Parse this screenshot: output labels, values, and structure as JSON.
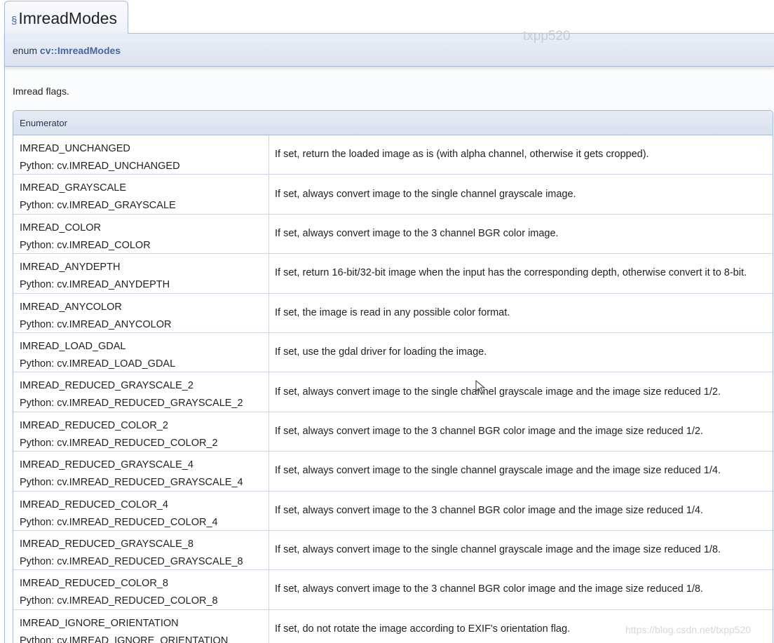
{
  "heading": {
    "anchor_symbol": "§",
    "title": "ImreadModes"
  },
  "declaration": {
    "keyword": "enum",
    "name": "cv::ImreadModes"
  },
  "description": "Imread flags.",
  "table": {
    "header": "Enumerator",
    "rows": [
      {
        "name": "IMREAD_UNCHANGED",
        "python": "Python: cv.IMREAD_UNCHANGED",
        "description": "If set, return the loaded image as is (with alpha channel, otherwise it gets cropped)."
      },
      {
        "name": "IMREAD_GRAYSCALE",
        "python": "Python: cv.IMREAD_GRAYSCALE",
        "description": "If set, always convert image to the single channel grayscale image."
      },
      {
        "name": "IMREAD_COLOR",
        "python": "Python: cv.IMREAD_COLOR",
        "description": "If set, always convert image to the 3 channel BGR color image."
      },
      {
        "name": "IMREAD_ANYDEPTH",
        "python": "Python: cv.IMREAD_ANYDEPTH",
        "description": "If set, return 16-bit/32-bit image when the input has the corresponding depth, otherwise convert it to 8-bit."
      },
      {
        "name": "IMREAD_ANYCOLOR",
        "python": "Python: cv.IMREAD_ANYCOLOR",
        "description": "If set, the image is read in any possible color format."
      },
      {
        "name": "IMREAD_LOAD_GDAL",
        "python": "Python: cv.IMREAD_LOAD_GDAL",
        "description": "If set, use the gdal driver for loading the image."
      },
      {
        "name": "IMREAD_REDUCED_GRAYSCALE_2",
        "python": "Python: cv.IMREAD_REDUCED_GRAYSCALE_2",
        "description": "If set, always convert image to the single channel grayscale image and the image size reduced 1/2."
      },
      {
        "name": "IMREAD_REDUCED_COLOR_2",
        "python": "Python: cv.IMREAD_REDUCED_COLOR_2",
        "description": "If set, always convert image to the 3 channel BGR color image and the image size reduced 1/2."
      },
      {
        "name": "IMREAD_REDUCED_GRAYSCALE_4",
        "python": "Python: cv.IMREAD_REDUCED_GRAYSCALE_4",
        "description": "If set, always convert image to the single channel grayscale image and the image size reduced 1/4."
      },
      {
        "name": "IMREAD_REDUCED_COLOR_4",
        "python": "Python: cv.IMREAD_REDUCED_COLOR_4",
        "description": "If set, always convert image to the 3 channel BGR color image and the image size reduced 1/4."
      },
      {
        "name": "IMREAD_REDUCED_GRAYSCALE_8",
        "python": "Python: cv.IMREAD_REDUCED_GRAYSCALE_8",
        "description": "If set, always convert image to the single channel grayscale image and the image size reduced 1/8."
      },
      {
        "name": "IMREAD_REDUCED_COLOR_8",
        "python": "Python: cv.IMREAD_REDUCED_COLOR_8",
        "description": "If set, always convert image to the 3 channel BGR color image and the image size reduced 1/8."
      },
      {
        "name": "IMREAD_IGNORE_ORIENTATION",
        "python": "Python: cv.IMREAD_IGNORE_ORIENTATION",
        "description": "If set, do not rotate the image according to EXIF's orientation flag."
      }
    ]
  },
  "watermarks": {
    "top": "txpp520",
    "bottom": "https://blog.csdn.net/txpp520"
  },
  "colors": {
    "link": "#4665a2",
    "border": "#a8b8d9",
    "header_bg": "#dde4f0"
  },
  "icons": {
    "cursor": "mouse-cursor-icon"
  }
}
